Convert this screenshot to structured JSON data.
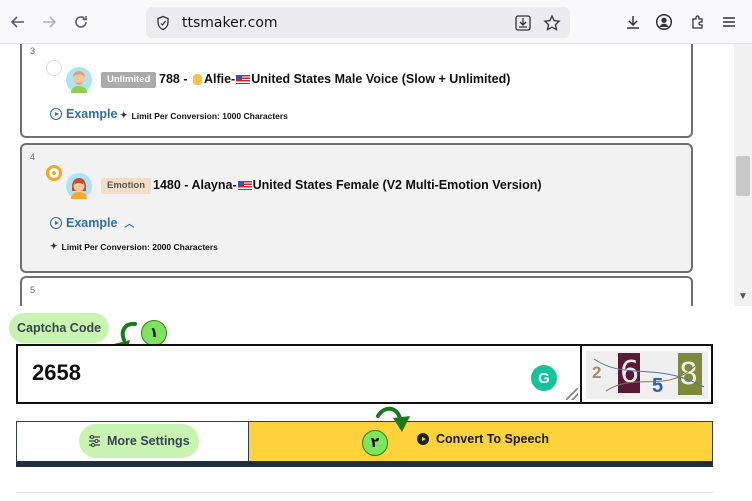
{
  "browser": {
    "url": "ttsmaker.com",
    "icons": [
      "back-arrow-icon",
      "forward-arrow-icon",
      "reload-icon",
      "site-info-icon",
      "install-app-icon",
      "bookmark-star-icon",
      "downloads-icon",
      "account-icon",
      "extensions-icon",
      "menu-icon"
    ]
  },
  "voices": [
    {
      "number": "3",
      "tag": "Unlimited",
      "id": "788",
      "separator": " - ",
      "name": "Alfie-",
      "description": "United States Male Voice (Slow + Unlimited)",
      "example_label": "Example",
      "limit_text": "Limit Per Conversion: 1000 Characters",
      "selected": false
    },
    {
      "number": "4",
      "tag": "Emotion",
      "id": "1480",
      "separator": " - ",
      "name": "Alayna-",
      "description": "United States Female (V2 Multi-Emotion Version)",
      "example_label": "Example",
      "limit_text": "Limit Per Conversion: 2000 Characters",
      "selected": true
    },
    {
      "number": "5"
    }
  ],
  "captcha": {
    "label": "Captcha Code",
    "value": "2658",
    "step_badge": "١",
    "image_chars": [
      "2",
      "6",
      "5",
      "8"
    ]
  },
  "actions": {
    "more_settings": "More Settings",
    "convert": "Convert To Speech",
    "step_badge": "٢"
  },
  "colors": {
    "accent_yellow": "#fdd23a",
    "highlight_green": "#c8f3b1",
    "badge_green": "#7ee45c",
    "link_blue": "#2d6fa7",
    "selected_orange": "#f5a623"
  }
}
